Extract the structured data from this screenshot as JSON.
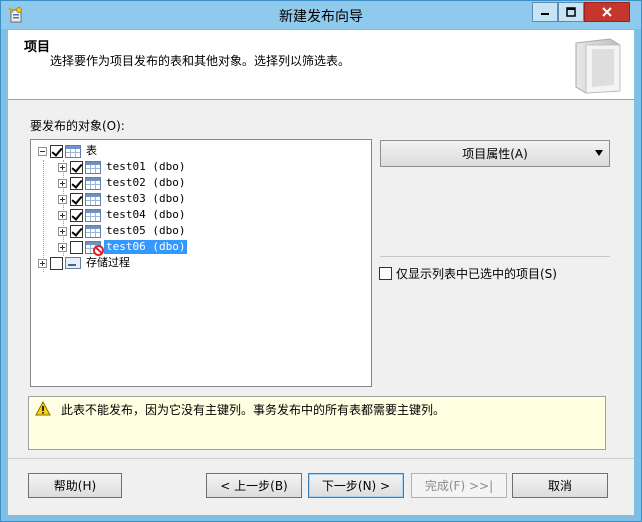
{
  "window": {
    "title": "新建发布向导"
  },
  "header": {
    "title": "项目",
    "subtitle": "选择要作为项目发布的表和其他对象。选择列以筛选表。"
  },
  "objects": {
    "label": "要发布的对象(O):",
    "tree": {
      "tables_node": {
        "label": "表",
        "checked": true,
        "expanded": true
      },
      "tables": [
        {
          "name": "test01 (dbo)",
          "checked": true,
          "error": false,
          "selected": false
        },
        {
          "name": "test02 (dbo)",
          "checked": true,
          "error": false,
          "selected": false
        },
        {
          "name": "test03 (dbo)",
          "checked": true,
          "error": false,
          "selected": false
        },
        {
          "name": "test04 (dbo)",
          "checked": true,
          "error": false,
          "selected": false
        },
        {
          "name": "test05 (dbo)",
          "checked": true,
          "error": false,
          "selected": false
        },
        {
          "name": "test06 (dbo)",
          "checked": false,
          "error": true,
          "selected": true
        }
      ],
      "procedures_node": {
        "label": "存储过程",
        "checked": false,
        "expanded": false
      }
    }
  },
  "article_properties": {
    "label": "项目属性(A)"
  },
  "show_selected": {
    "label": "仅显示列表中已选中的项目(S)",
    "checked": false
  },
  "message": {
    "text": "此表不能发布，因为它没有主键列。事务发布中的所有表都需要主键列。"
  },
  "buttons": {
    "help": "帮助(H)",
    "back": "< 上一步(B)",
    "next": "下一步(N) >",
    "finish": "完成(F) >>|",
    "cancel": "取消"
  }
}
